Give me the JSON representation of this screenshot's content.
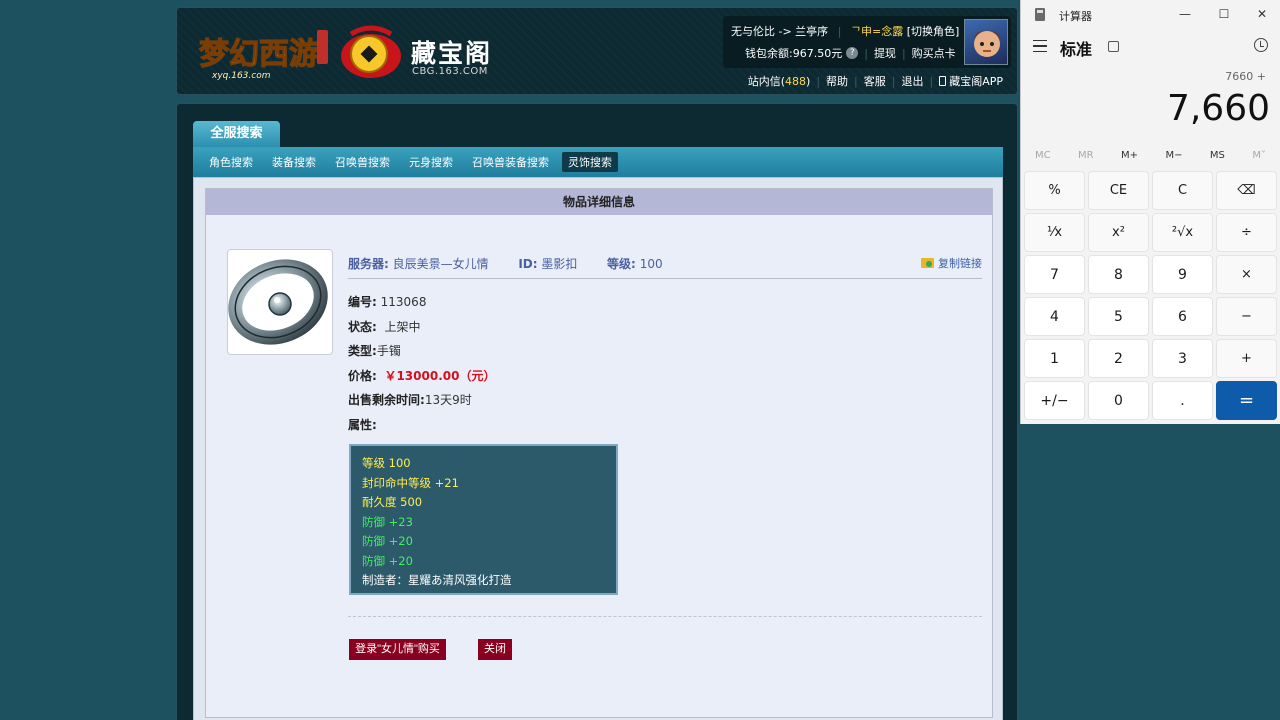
{
  "header": {
    "logo_brand": "梦幻西游",
    "logo_url": "xyq.163.com",
    "cbg_title": "藏宝阁",
    "cbg_url": "CBG.163.COM",
    "user": {
      "server_path": "无与伦比 -> 兰亭序",
      "character": "ᄀ申=念露",
      "switch_role": "[切换角色]",
      "balance_label": "钱包余额:",
      "balance_value": "967.50元",
      "withdraw": "提现",
      "buy_card": "购买点卡"
    },
    "nav": {
      "messages_label": "站内信",
      "messages_count": "488",
      "help": "帮助",
      "service": "客服",
      "logout": "退出",
      "app": "藏宝阁APP"
    }
  },
  "search": {
    "main_tab": "全服搜索",
    "tabs": [
      "角色搜索",
      "装备搜索",
      "召唤兽搜索",
      "元身搜索",
      "召唤兽装备搜索",
      "灵饰搜索"
    ],
    "active_tab": 5
  },
  "detail": {
    "title": "物品详细信息",
    "server_label": "服务器:",
    "server_value": "良辰美景—女儿情",
    "id_label": "ID:",
    "id_value": "墨影扣",
    "level_label": "等级:",
    "level_value": "100",
    "copy_link": "复制链接",
    "rows": [
      {
        "k": "编号:",
        "v": "113068"
      },
      {
        "k": "状态:",
        "v": "上架中"
      },
      {
        "k": "类型:",
        "v": "手镯"
      },
      {
        "k": "价格:",
        "v": "￥13000.00（元）"
      },
      {
        "k": "出售剩余时间:",
        "v": "13天9时"
      },
      {
        "k": "属性:",
        "v": ""
      }
    ],
    "attributes": [
      {
        "text": "等级 100",
        "color": "yellow"
      },
      {
        "text": "封印命中等级 +21",
        "color": "yellow"
      },
      {
        "text": "耐久度 500",
        "color": "yellow"
      },
      {
        "text": "防御 +23",
        "color": "green"
      },
      {
        "text": "防御 +20",
        "color": "green"
      },
      {
        "text": "防御 +20",
        "color": "green"
      },
      {
        "text": "制造者：星耀あ清风强化打造",
        "color": "white"
      }
    ],
    "buy_button": "登录\"女儿情\"购买",
    "close_button": "关闭"
  },
  "calculator": {
    "app_title": "计算器",
    "mode": "标准",
    "expression": "7660 +",
    "display": "7,660",
    "memory": [
      "MC",
      "MR",
      "M+",
      "M−",
      "MS",
      "M˅"
    ],
    "memory_dim": [
      true,
      true,
      false,
      false,
      false,
      true
    ],
    "keys": [
      "%",
      "CE",
      "C",
      "⌫",
      "¹⁄x",
      "x²",
      "²√x",
      "÷",
      "7",
      "8",
      "9",
      "×",
      "4",
      "5",
      "6",
      "−",
      "1",
      "2",
      "3",
      "+",
      "+/−",
      "0",
      ".",
      "="
    ],
    "minimize": "—",
    "maximize": "☐",
    "close": "✕"
  },
  "colors": {
    "background": "#1d5160",
    "price": "#d4101c",
    "buy_button": "#8a0020",
    "calc_equals": "#0f5bab",
    "attr_yellow": "#ffee50",
    "attr_green": "#3ff25b"
  }
}
